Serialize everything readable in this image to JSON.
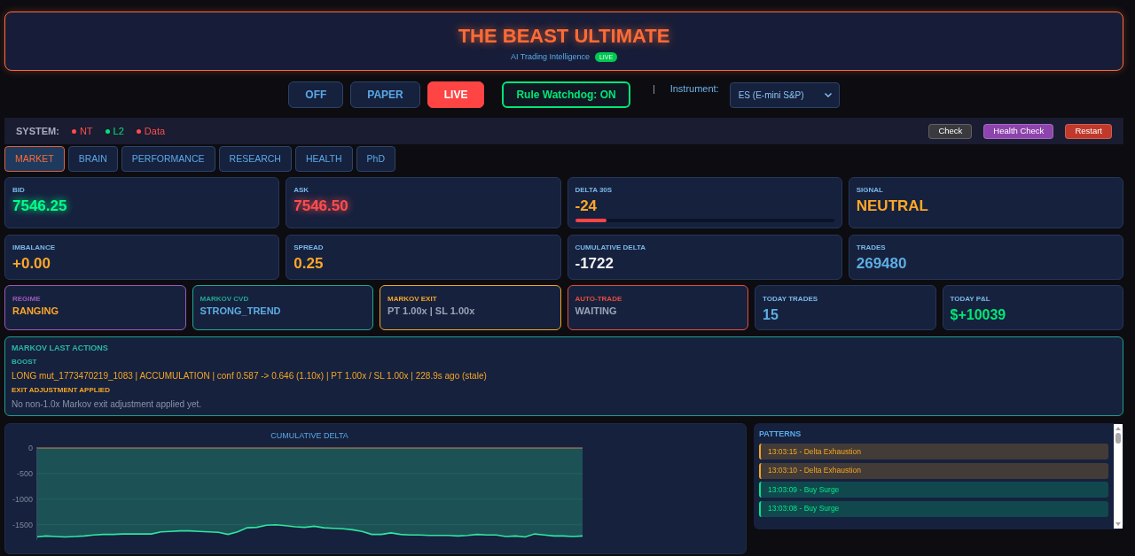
{
  "header": {
    "title": "THE BEAST ULTIMATE",
    "subtitle": "AI Trading Intelligence",
    "badge": "LIVE"
  },
  "modes": [
    {
      "label": "OFF",
      "selected": false
    },
    {
      "label": "PAPER",
      "selected": false
    },
    {
      "label": "LIVE",
      "selected": true
    }
  ],
  "watchdog": {
    "label": "Rule Watchdog: ON",
    "on": true
  },
  "instrument": {
    "label": "Instrument:",
    "value": "ES (E-mini S&P)"
  },
  "system_bar": {
    "label": "SYSTEM:",
    "indicators": [
      {
        "label": "NT",
        "color": "#ff4d4d"
      },
      {
        "label": "L2",
        "color": "#00e676"
      },
      {
        "label": "Data",
        "color": "#ff4d4d"
      }
    ],
    "buttons": [
      {
        "label": "Check",
        "color": "#3a3a3e"
      },
      {
        "label": "Health Check",
        "color": "#8e44ad"
      },
      {
        "label": "Restart",
        "color": "#c0392b"
      }
    ]
  },
  "tabs": [
    {
      "label": "MARKET",
      "selected": true
    },
    {
      "label": "BRAIN",
      "selected": false
    },
    {
      "label": "PERFORMANCE",
      "selected": false
    },
    {
      "label": "RESEARCH",
      "selected": false
    },
    {
      "label": "HEALTH",
      "selected": false
    },
    {
      "label": "PhD",
      "selected": false
    }
  ],
  "metrics": [
    {
      "kind": "value",
      "label": "BID",
      "value": "7546.25",
      "color": "#00ff88",
      "glow": true
    },
    {
      "kind": "value",
      "label": "ASK",
      "value": "7546.50",
      "color": "#ff4d4d",
      "glow": true
    },
    {
      "kind": "meter",
      "label": "DELTA 30S",
      "value": "-24",
      "color": "#ffa726",
      "glow": false,
      "level": 0.12
    },
    {
      "kind": "value",
      "label": "SIGNAL",
      "value": "NEUTRAL",
      "color": "#ffa726",
      "glow": false
    },
    {
      "kind": "value",
      "label": "IMBALANCE",
      "value": "+0.00",
      "color": "#ffa726",
      "glow": false
    },
    {
      "kind": "value",
      "label": "SPREAD",
      "value": "0.25",
      "color": "#ffa726",
      "glow": false
    },
    {
      "kind": "value",
      "label": "CUMULATIVE DELTA",
      "value": "-1722",
      "color": "#f2f2f2",
      "glow": false
    },
    {
      "kind": "value",
      "label": "TRADES",
      "value": "269480",
      "color": "#5dade2",
      "glow": false
    }
  ],
  "status_cards": [
    {
      "kind": "text",
      "label": "REGIME",
      "color": "#9b59b6",
      "value": {
        "text": "RANGING",
        "color": "#ffa726"
      }
    },
    {
      "kind": "text",
      "label": "MARKOV CVD",
      "color": "#1fa98f",
      "value": {
        "text": "STRONG_TREND",
        "color": "#5dade2"
      }
    },
    {
      "kind": "text",
      "label": "MARKOV EXIT",
      "color": "#f5a623",
      "value": {
        "text": "PT 1.00x | SL 1.00x",
        "color": "#9aa3b5"
      }
    },
    {
      "kind": "text",
      "label": "AUTO-TRADE",
      "color": "#e74c3c",
      "value": {
        "text": "WAITING",
        "color": "#9aa3b5"
      }
    },
    {
      "kind": "stat",
      "label": "TODAY TRADES",
      "value": {
        "text": "15",
        "color": "#5dade2"
      }
    },
    {
      "kind": "stat",
      "label": "TODAY P&L",
      "value": {
        "text": "$+10039",
        "color": "#00e676"
      }
    }
  ],
  "markov": {
    "title": "MARKOV LAST ACTIONS",
    "sections": [
      {
        "heading": {
          "text": "BOOST",
          "color": "#2ab7a0"
        },
        "body": {
          "text": "LONG mut_1773470219_1083 | ACCUMULATION | conf 0.587 -> 0.646 (1.10x) | PT 1.00x / SL 1.00x | 228.9s ago (stale)",
          "color": "#f5a623"
        }
      },
      {
        "heading": {
          "text": "EXIT ADJUSTMENT APPLIED",
          "color": "#f5a623"
        },
        "body": {
          "text": "No non-1.0x Markov exit adjustment applied yet.",
          "color": "#8a93a6"
        }
      }
    ]
  },
  "chart_panel": {
    "chart_data": {
      "type": "area",
      "title": "CUMULATIVE DELTA",
      "yticks": [
        0,
        -500,
        -1000,
        -1500
      ],
      "ylim": [
        -1800,
        0
      ],
      "grid": true,
      "series": [
        {
          "color": "#2ee6a0",
          "values": [
            -1740,
            -1720,
            -1730,
            -1740,
            -1730,
            -1720,
            -1700,
            -1690,
            -1690,
            -1680,
            -1680,
            -1680,
            -1680,
            -1640,
            -1630,
            -1620,
            -1620,
            -1630,
            -1640,
            -1650,
            -1690,
            -1640,
            -1560,
            -1550,
            -1510,
            -1500,
            -1520,
            -1540,
            -1550,
            -1530,
            -1560,
            -1570,
            -1580,
            -1600,
            -1630,
            -1690,
            -1690,
            -1660,
            -1690,
            -1700,
            -1700,
            -1710,
            -1710,
            -1710,
            -1720,
            -1710,
            -1690,
            -1700,
            -1700,
            -1730,
            -1720,
            -1740,
            -1680,
            -1700,
            -1720,
            -1720,
            -1730,
            -1720
          ]
        }
      ]
    }
  },
  "patterns": {
    "title": "PATTERNS",
    "items": [
      {
        "text": "13:03:15 - Delta Exhaustion",
        "color": "#f5a623"
      },
      {
        "text": "13:03:10 - Delta Exhaustion",
        "color": "#f5a623"
      },
      {
        "text": "13:03:09 - Buy Surge",
        "color": "#00e68a"
      },
      {
        "text": "13:03:08 - Buy Surge",
        "color": "#00e68a"
      }
    ]
  }
}
